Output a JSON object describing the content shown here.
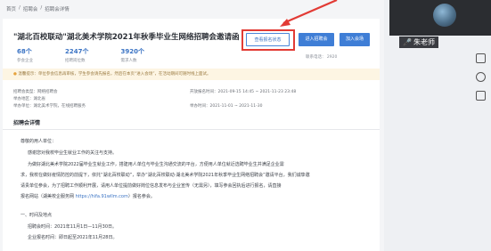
{
  "breadcrumb": [
    "首页",
    "招聘会",
    "招聘会详情"
  ],
  "title": "\"湖北百校联动\"湖北美术学院2021年秋季毕业生网络招聘会邀请函",
  "stats": [
    {
      "value": "68个",
      "label": "参会企业"
    },
    {
      "value": "2247个",
      "label": "招聘岗位数"
    },
    {
      "value": "3920个",
      "label": "需求人数"
    }
  ],
  "buttons": {
    "view_status": "查看报名状态",
    "enter_venue": "进入招聘会",
    "join": "加入会场"
  },
  "contact": "联系电话：  2920",
  "notice": "温馨提示：单位参会信息再审核，学生参会请先报名，然后在本页“进入会场”，在活动期间可随时线上面试。",
  "info": {
    "type_label": "招聘会类型：网络招聘会",
    "region_label": "举办地区：湖北省",
    "host_label": "举办单位：湖北美术学院，在线招聘服务",
    "reg_time": "开放报名时间：2021-09-15 14:45 ~ 2021-11-23 23:48",
    "hold_time": "举办时间：2021-11-01 ~ 2021-11-30"
  },
  "section_title": "招聘会详情",
  "body": {
    "greeting": "尊敬的用人单位：",
    "line1": "感谢您对我校毕业生就业工作的关注与支持。",
    "line2": "为做好湖北美术学院2022届毕业生就业工作，搭建用人单位与毕业生沟通交流的平台，方便用人单位就近选聘毕业生并满足企业需",
    "line3": "求，我校在做好疫情防控的前提下，依托“湖北百校联动”，举办“湖北百校联动·湖北美术学院2021年秋季毕业生网络招聘会”邀请平台，我们诚挚邀",
    "line4": "请贵单位参会，为了招聘工作顺利开展，请用人单位提前做好岗位信息发布与企业宣传（无需另），填写参会回执后进行报名，请直接",
    "line5a": "报名网站（湖美校企服务网 ",
    "line5_link": "https://hifa.91wllm.com",
    "line5b": "）报名参会。",
    "sec1": "一、时间及地点",
    "time": "招聘会时间：2021年11月1日—11月30日。",
    "reg": "企业报名时间：即日起至2021年11月28日。"
  },
  "sidebar": {
    "speaker_name": "朱老师"
  },
  "colors": {
    "accent": "#3f7ed6",
    "highlight": "#e23b35",
    "notice_bg": "#fdf5e3"
  }
}
